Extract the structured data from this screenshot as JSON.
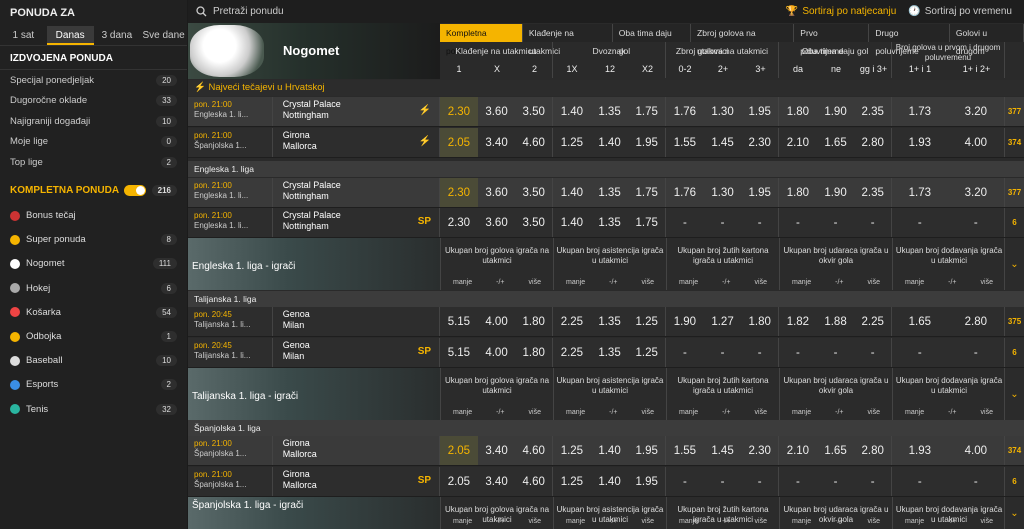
{
  "sidebar": {
    "title": "PONUDA ZA",
    "tabs": [
      "1 sat",
      "Danas",
      "3 dana",
      "Sve dane"
    ],
    "section": "IZDVOJENA PONUDA",
    "featured": [
      {
        "label": "Specijal ponedjeljak",
        "count": "20"
      },
      {
        "label": "Dugoročne oklade",
        "count": "33"
      },
      {
        "label": "Najigraniji događaji",
        "count": "10"
      },
      {
        "label": "Moje lige",
        "count": "0"
      },
      {
        "label": "Top lige",
        "count": "2"
      }
    ],
    "komplet": {
      "label": "KOMPLETNA PONUDA",
      "count": "216"
    },
    "sports": [
      {
        "label": "Bonus tečaj",
        "count": "",
        "color": "#c33"
      },
      {
        "label": "Super ponuda",
        "count": "8",
        "color": "#f5b400"
      },
      {
        "label": "Nogomet",
        "count": "111",
        "color": "#fff"
      },
      {
        "label": "Hokej",
        "count": "6",
        "color": "#aaa"
      },
      {
        "label": "Košarka",
        "count": "54",
        "color": "#e44"
      },
      {
        "label": "Odbojka",
        "count": "1",
        "color": "#f5b400"
      },
      {
        "label": "Baseball",
        "count": "10",
        "color": "#ddd"
      },
      {
        "label": "Esports",
        "count": "2",
        "color": "#3a8ee6"
      },
      {
        "label": "Tenis",
        "count": "32",
        "color": "#2ab5a0"
      }
    ]
  },
  "top": {
    "search": "Pretraži ponudu",
    "sort1": "Sortiraj po natjecanju",
    "sort2": "Sortiraj po vremenu"
  },
  "banner": {
    "title": "Nogomet"
  },
  "mtabs": [
    "Kompletna ponuda",
    "Klađenje na utakmici",
    "Oba tima daju gol",
    "Zbroj golova na utakmici",
    "Prvo poluvrijeme",
    "Drugo poluvrijeme",
    "Golovi u drugom"
  ],
  "groups": [
    {
      "title": "Klađenje na utakmicu",
      "subs": [
        "1",
        "X",
        "2"
      ]
    },
    {
      "title": "Dvoznak",
      "subs": [
        "1X",
        "12",
        "X2"
      ]
    },
    {
      "title": "Zbroj golova na utakmici",
      "subs": [
        "0-2",
        "2+",
        "3+"
      ]
    },
    {
      "title": "Oba tima daju gol",
      "subs": [
        "da",
        "ne",
        "gg i 3+"
      ]
    },
    {
      "title": "Broj golova u prvom i drugom poluvremenu",
      "subs": [
        "1+ i 1",
        "1+ i 2+"
      ]
    }
  ],
  "sections": {
    "hot": "Najveći tečajevi u Hrvatskoj",
    "eng": "Engleska 1. liga",
    "ita": "Talijanska 1. liga",
    "spa": "Španjolska 1. liga"
  },
  "rows": [
    {
      "time": "pon. 21:00",
      "league": "Engleska 1. li...",
      "t1": "Crystal Palace",
      "t2": "Nottingham",
      "ind": "⚡",
      "odds": [
        "2.30",
        "3.60",
        "3.50",
        "1.40",
        "1.35",
        "1.75",
        "1.76",
        "1.30",
        "1.95",
        "1.80",
        "1.90",
        "2.35",
        "1.73",
        "3.20"
      ],
      "count": "377"
    },
    {
      "time": "pon. 21:00",
      "league": "Španjolska 1...",
      "t1": "Girona",
      "t2": "Mallorca",
      "ind": "⚡",
      "odds": [
        "2.05",
        "3.40",
        "4.60",
        "1.25",
        "1.40",
        "1.95",
        "1.55",
        "1.45",
        "2.30",
        "2.10",
        "1.65",
        "2.80",
        "1.93",
        "4.00"
      ],
      "count": "374"
    },
    {
      "time": "pon. 21:00",
      "league": "Engleska 1. li...",
      "t1": "Crystal Palace",
      "t2": "Nottingham",
      "ind": "",
      "odds": [
        "2.30",
        "3.60",
        "3.50",
        "1.40",
        "1.35",
        "1.75",
        "1.76",
        "1.30",
        "1.95",
        "1.80",
        "1.90",
        "2.35",
        "1.73",
        "3.20"
      ],
      "count": "377"
    },
    {
      "time": "pon. 21:00",
      "league": "Engleska 1. li...",
      "t1": "Crystal Palace",
      "t2": "Nottingham",
      "ind": "SP",
      "odds": [
        "2.30",
        "3.60",
        "3.50",
        "1.40",
        "1.35",
        "1.75",
        "-",
        "-",
        "-",
        "-",
        "-",
        "-",
        "-",
        "-"
      ],
      "count": "6"
    },
    {
      "time": "pon. 20:45",
      "league": "Talijanska 1. li...",
      "t1": "Genoa",
      "t2": "Milan",
      "ind": "",
      "odds": [
        "5.15",
        "4.00",
        "1.80",
        "2.25",
        "1.35",
        "1.25",
        "1.90",
        "1.27",
        "1.80",
        "1.82",
        "1.88",
        "2.25",
        "1.65",
        "2.80"
      ],
      "count": "375"
    },
    {
      "time": "pon. 20:45",
      "league": "Talijanska 1. li...",
      "t1": "Genoa",
      "t2": "Milan",
      "ind": "SP",
      "odds": [
        "5.15",
        "4.00",
        "1.80",
        "2.25",
        "1.35",
        "1.25",
        "-",
        "-",
        "-",
        "-",
        "-",
        "-",
        "-",
        "-"
      ],
      "count": "6"
    },
    {
      "time": "pon. 21:00",
      "league": "Španjolska 1...",
      "t1": "Girona",
      "t2": "Mallorca",
      "ind": "",
      "odds": [
        "2.05",
        "3.40",
        "4.60",
        "1.25",
        "1.40",
        "1.95",
        "1.55",
        "1.45",
        "2.30",
        "2.10",
        "1.65",
        "2.80",
        "1.93",
        "4.00"
      ],
      "count": "374"
    },
    {
      "time": "pon. 21:00",
      "league": "Španjolska 1...",
      "t1": "Girona",
      "t2": "Mallorca",
      "ind": "SP",
      "odds": [
        "2.05",
        "3.40",
        "4.60",
        "1.25",
        "1.40",
        "1.95",
        "-",
        "-",
        "-",
        "-",
        "-",
        "-",
        "-",
        "-"
      ],
      "count": "6"
    }
  ],
  "players": [
    {
      "title": "Engleska 1. liga - igrači"
    },
    {
      "title": "Talijanska 1. liga - igrači"
    },
    {
      "title": "Španjolska 1. liga - igrači"
    }
  ],
  "pcols": [
    {
      "title": "Ukupan broj golova igrača na utakmici",
      "labels": [
        "manje",
        "-/+",
        "više"
      ]
    },
    {
      "title": "Ukupan broj asistencija igrača u utakmici",
      "labels": [
        "manje",
        "-/+",
        "više"
      ]
    },
    {
      "title": "Ukupan broj žutih kartona igrača u utakmici",
      "labels": [
        "manje",
        "-/+",
        "više"
      ]
    },
    {
      "title": "Ukupan broj udaraca igrača u okvir gola",
      "labels": [
        "manje",
        "-/+",
        "više"
      ]
    },
    {
      "title": "Ukupan broj dodavanja igrača u utakmici",
      "labels": [
        "manje",
        "-/+",
        "više"
      ]
    }
  ]
}
